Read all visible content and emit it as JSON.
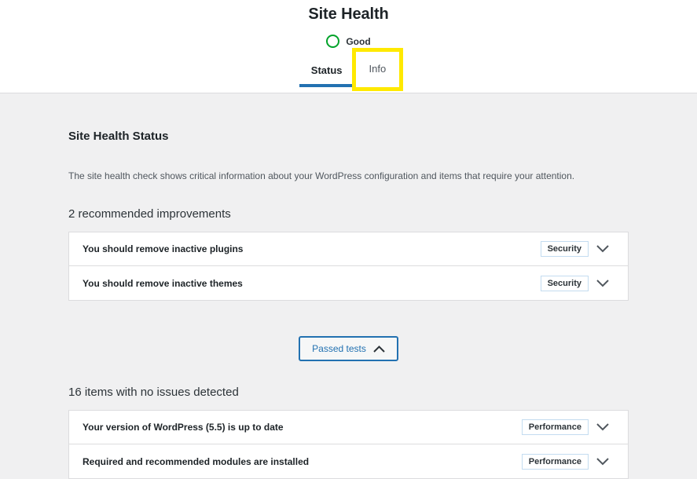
{
  "header": {
    "title": "Site Health",
    "status_label": "Good",
    "status_icon": "green-circle-icon",
    "status_color": "#00a32a",
    "tabs": [
      {
        "label": "Status",
        "active": true,
        "highlighted": false
      },
      {
        "label": "Info",
        "active": false,
        "highlighted": true
      }
    ],
    "highlight_color": "#ffe900",
    "active_tab_underline_color": "#2271b1"
  },
  "main": {
    "section_title": "Site Health Status",
    "intro_text": "The site health check shows critical information about your WordPress configuration and items that require your attention.",
    "improvements": {
      "heading": "2 recommended improvements",
      "rows": [
        {
          "label": "You should remove inactive plugins",
          "badge": "Security",
          "chevron": "chevron-down-icon"
        },
        {
          "label": "You should remove inactive themes",
          "badge": "Security",
          "chevron": "chevron-down-icon"
        }
      ]
    },
    "passed_tests_button": {
      "label": "Passed tests",
      "chevron": "chevron-up-icon",
      "accent_color": "#2271b1"
    },
    "passed": {
      "heading": "16 items with no issues detected",
      "rows": [
        {
          "label": "Your version of WordPress (5.5) is up to date",
          "badge": "Performance",
          "chevron": "chevron-down-icon"
        },
        {
          "label": "Required and recommended modules are installed",
          "badge": "Performance",
          "chevron": "chevron-down-icon"
        }
      ]
    }
  }
}
